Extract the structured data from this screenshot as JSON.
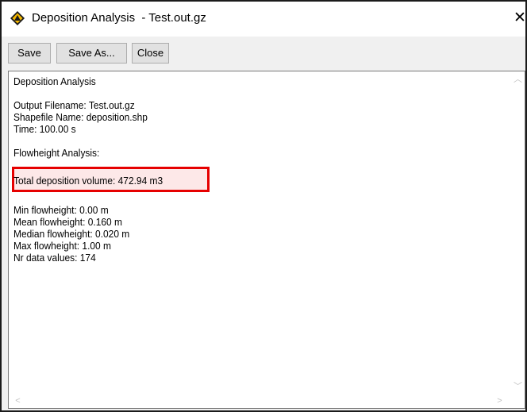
{
  "window": {
    "title": "Deposition Analysis  - Test.out.gz",
    "close_glyph": "✕",
    "icon": "warning-diamond-icon"
  },
  "toolbar": {
    "save_label": "Save",
    "save_as_label": "Save As...",
    "close_label": "Close"
  },
  "report": {
    "heading": "Deposition Analysis",
    "output_filename": "Output Filename: Test.out.gz",
    "shapefile_name": "Shapefile Name: deposition.shp",
    "time": "Time: 100.00 s",
    "flowheight_heading": "Flowheight Analysis:",
    "total_deposition": "Total deposition volume: 472.94 m3",
    "min_flowheight": "Min flowheight: 0.00 m",
    "mean_flowheight": "Mean flowheight: 0.160 m",
    "median_flowheight": "Median flowheight: 0.020 m",
    "max_flowheight": "Max flowheight: 1.00 m",
    "nr_data_values": "Nr data values: 174"
  },
  "colors": {
    "highlight_border": "#e60000",
    "highlight_fill": "#fde8e8"
  }
}
